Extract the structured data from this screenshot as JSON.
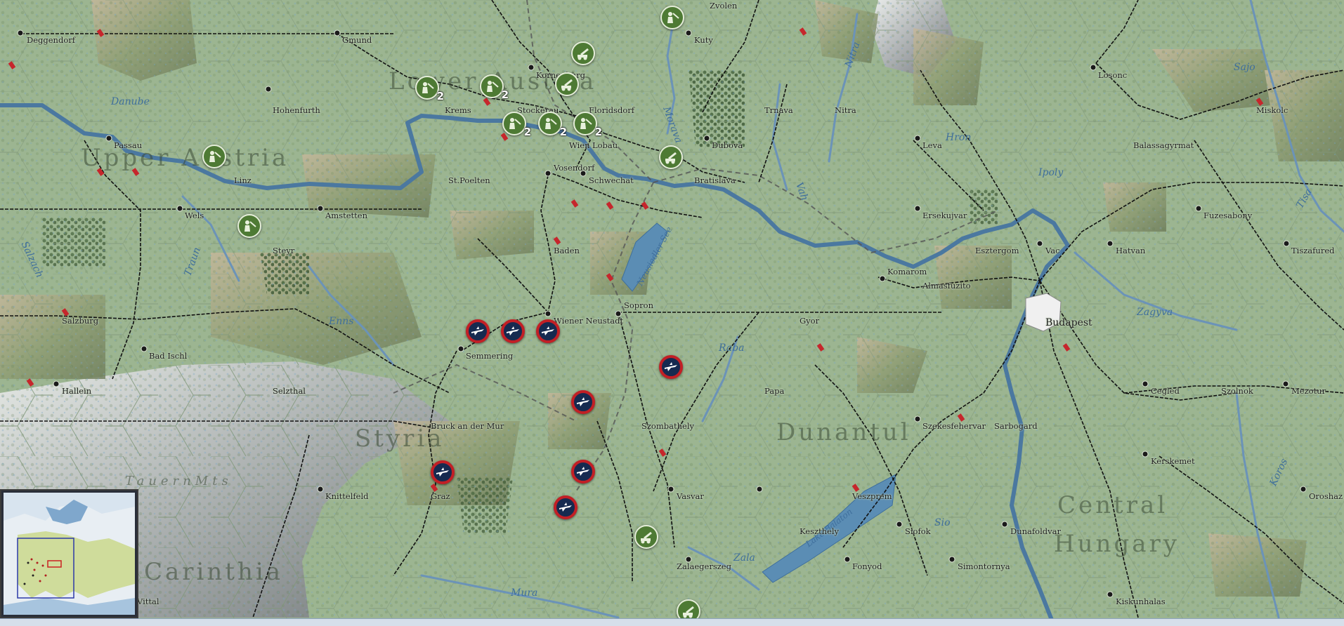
{
  "map": {
    "regions": [
      {
        "id": "lower-austria",
        "text": "Lower Austria"
      },
      {
        "id": "upper-austria",
        "text": "Upper Austria"
      },
      {
        "id": "styria",
        "text": "Styria"
      },
      {
        "id": "carinthia",
        "text": "Carinthia"
      },
      {
        "id": "dunantul",
        "text": "Dunantul"
      },
      {
        "id": "central",
        "text": "Central"
      },
      {
        "id": "hungary",
        "text": "Hungary"
      },
      {
        "id": "tauern",
        "text": "TauernMts"
      }
    ],
    "rivers": [
      "Danube",
      "Traun",
      "Enns",
      "Morava",
      "Nitra",
      "Hron",
      "Vah",
      "Ipoly",
      "Sajo",
      "Tisa",
      "Raba",
      "Zala",
      "Mura",
      "Sio",
      "Zagyva",
      "Koros",
      "Salzach",
      "Neusiedler See",
      "Lake Balaton"
    ],
    "cities": [
      "Deggendorf",
      "Gmund",
      "Zvolen",
      "Kuty",
      "Kornenburg",
      "Hohenfurth",
      "Krems",
      "Stockerau",
      "Floridsdorf",
      "Passau",
      "Wien",
      "Lobau",
      "Trnava",
      "Nitra",
      "Miskolc",
      "Losonc",
      "Dubova",
      "Leva",
      "Balassagyrmat",
      "Linz",
      "St.Poelten",
      "Vosendorf",
      "Schwechat",
      "Bratislava",
      "Wels",
      "Amstetten",
      "Ersekujvar",
      "Fuzesabony",
      "Steyr",
      "Baden",
      "Esztergom",
      "Vac",
      "Hatvan",
      "Tiszafured",
      "Komarom",
      "Almasfuzito",
      "Sopron",
      "Salzburg",
      "Wiener Neustadt",
      "Gyor",
      "Budapest",
      "Bad Ischl",
      "Semmering",
      "Hallein",
      "Selzthal",
      "Papa",
      "Cegled",
      "Szolnok",
      "Mezotur",
      "Bruck an der Mur",
      "Szombathely",
      "Szekesfehervar",
      "Sarbogard",
      "Kerskemet",
      "Graz",
      "Knittelfeld",
      "Vasvar",
      "Veszprem",
      "Oroshaz",
      "Keszthely",
      "Siofok",
      "Dunafoldvar",
      "Zalaegerszeg",
      "Fonyod",
      "Simontornya",
      "Kiskunhalas",
      "Vittal"
    ]
  },
  "units": [
    {
      "side": "axis",
      "type": "inf",
      "count": ""
    },
    {
      "side": "axis",
      "type": "inf",
      "count": "2"
    },
    {
      "side": "axis",
      "type": "inf",
      "count": "2"
    },
    {
      "side": "axis",
      "type": "inf",
      "count": ""
    },
    {
      "side": "axis",
      "type": "inf",
      "count": ""
    },
    {
      "side": "axis",
      "type": "inf",
      "count": "2"
    },
    {
      "side": "axis",
      "type": "inf",
      "count": "2"
    },
    {
      "side": "axis",
      "type": "inf",
      "count": "2"
    },
    {
      "side": "axis",
      "type": "art",
      "count": ""
    },
    {
      "side": "axis",
      "type": "art",
      "count": ""
    },
    {
      "side": "axis",
      "type": "art",
      "count": ""
    },
    {
      "side": "axis",
      "type": "art",
      "count": ""
    },
    {
      "side": "axis",
      "type": "art",
      "count": ""
    },
    {
      "side": "allied",
      "type": "air",
      "count": ""
    },
    {
      "side": "allied",
      "type": "air",
      "count": ""
    },
    {
      "side": "allied",
      "type": "air",
      "count": ""
    },
    {
      "side": "allied",
      "type": "air",
      "count": ""
    },
    {
      "side": "allied",
      "type": "air",
      "count": ""
    },
    {
      "side": "allied",
      "type": "air",
      "count": ""
    },
    {
      "side": "allied",
      "type": "air",
      "count": ""
    },
    {
      "side": "allied",
      "type": "air",
      "count": ""
    }
  ],
  "colors": {
    "terrain": "#9cb591",
    "water": "#4d7ea3",
    "river": "#5e88ad",
    "rail": "#111111",
    "axis": "#4e7a34",
    "allied_ring": "#c21f25",
    "allied_fill": "#162a50"
  }
}
